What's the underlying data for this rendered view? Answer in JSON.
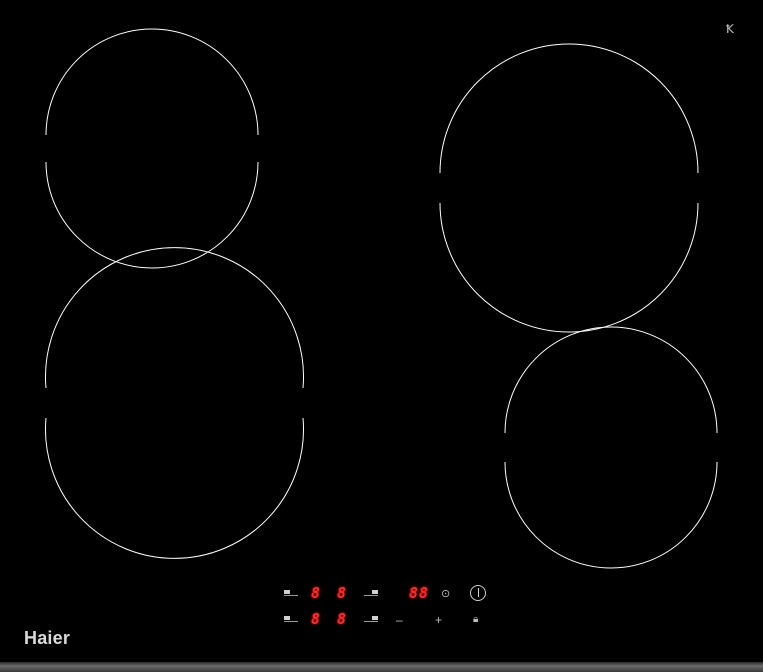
{
  "brand": {
    "name": "Haier"
  },
  "corner_mark": "Ꝁ",
  "display": {
    "top_left": "8",
    "top_right": "8",
    "bottom_left": "8",
    "bottom_right": "8",
    "timer": "88"
  },
  "controls": {
    "timer_icon": "⊙",
    "minus": "–",
    "plus": "+",
    "lock_icon": "🔒︎"
  },
  "icons": {
    "power": "power-icon",
    "timer": "timer-icon",
    "lock": "lock-icon"
  },
  "colors": {
    "surface": "#000000",
    "display": "#ff2a2a",
    "ring": "#ffffff",
    "brand": "#d9d9d9"
  }
}
